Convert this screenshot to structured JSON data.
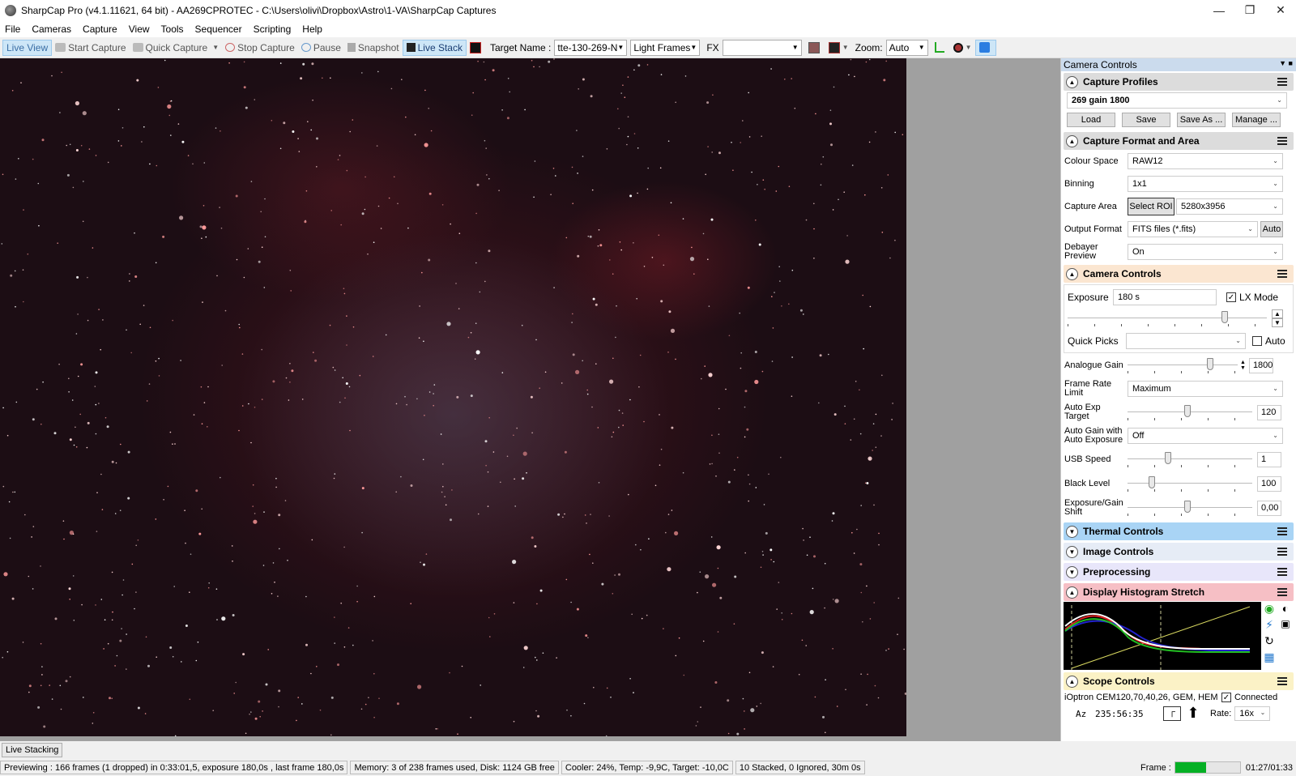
{
  "window": {
    "title": "SharpCap Pro (v4.1.11621, 64 bit) - AA269CPROTEC - C:\\Users\\olivi\\Dropbox\\Astro\\1-VA\\SharpCap Captures"
  },
  "menu": [
    "File",
    "Cameras",
    "Capture",
    "View",
    "Tools",
    "Sequencer",
    "Scripting",
    "Help"
  ],
  "toolbar": {
    "live_view": "Live View",
    "start_capture": "Start Capture",
    "quick_capture": "Quick Capture",
    "stop_capture": "Stop Capture",
    "pause": "Pause",
    "snapshot": "Snapshot",
    "live_stack": "Live Stack",
    "target_name_label": "Target Name :",
    "target_name_value": "tte-130-269-N",
    "frame_type": "Light Frames",
    "fx_label": "FX",
    "fx_value": "",
    "zoom_label": "Zoom:",
    "zoom_value": "Auto"
  },
  "panel": {
    "title": "Camera Controls",
    "capture_profiles": {
      "title": "Capture Profiles",
      "selected": "269 gain 1800",
      "load": "Load",
      "save": "Save",
      "save_as": "Save As ...",
      "manage": "Manage ..."
    },
    "format": {
      "title": "Capture Format and Area",
      "colour_space_label": "Colour Space",
      "colour_space": "RAW12",
      "binning_label": "Binning",
      "binning": "1x1",
      "capture_area_label": "Capture Area",
      "select_roi": "Select ROI",
      "capture_area": "5280x3956",
      "output_format_label": "Output Format",
      "output_format": "FITS files (*.fits)",
      "auto": "Auto",
      "debayer_label": "Debayer Preview",
      "debayer": "On"
    },
    "camera": {
      "title": "Camera Controls",
      "exposure_label": "Exposure",
      "exposure": "180 s",
      "lx_mode": "LX Mode",
      "quick_picks_label": "Quick Picks",
      "quick_picks_auto": "Auto",
      "analogue_gain_label": "Analogue Gain",
      "analogue_gain": "1800",
      "frame_rate_label": "Frame Rate Limit",
      "frame_rate": "Maximum",
      "auto_exp_label": "Auto Exp Target",
      "auto_exp": "120",
      "auto_gain_label": "Auto Gain with Auto Exposure",
      "auto_gain": "Off",
      "usb_label": "USB Speed",
      "usb": "1",
      "black_label": "Black Level",
      "black": "100",
      "shift_label": "Exposure/Gain Shift",
      "shift": "0,00"
    },
    "thermal": "Thermal Controls",
    "image_controls": "Image Controls",
    "preprocessing": "Preprocessing",
    "histogram": "Display Histogram Stretch",
    "scope": {
      "title": "Scope Controls",
      "mount": "iOptron CEM120,70,40,26, GEM, HEM",
      "connected": "Connected",
      "az_label": "Az",
      "az_value": "235:56:35",
      "rate_label": "Rate:",
      "rate": "16x"
    }
  },
  "tabs": {
    "live_stacking": "Live Stacking"
  },
  "status": {
    "preview": "Previewing : 166 frames (1 dropped) in 0:33:01,5, exposure 180,0s , last frame 180,0s",
    "memory": "Memory: 3 of 238 frames used, Disk: 1124 GB free",
    "cooler": "Cooler: 24%, Temp: -9,9C, Target: -10,0C",
    "stacked": "10 Stacked, 0 Ignored, 30m 0s",
    "frame_label": "Frame :",
    "frame_progress": 0.48,
    "time": "01:27/01:33"
  }
}
